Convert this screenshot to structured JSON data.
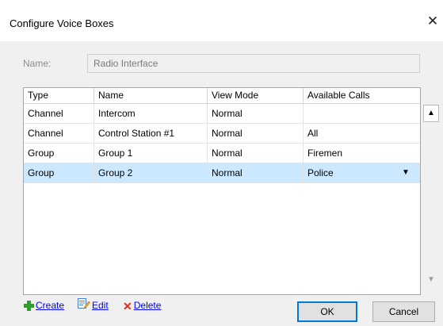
{
  "window": {
    "title": "Configure Voice Boxes",
    "close_glyph": "✕"
  },
  "name_field": {
    "label": "Name:",
    "value": "Radio Interface"
  },
  "grid": {
    "columns": [
      "Type",
      "Name",
      "View Mode",
      "Available Calls"
    ],
    "rows": [
      {
        "type": "Channel",
        "name": "Intercom",
        "view_mode": "Normal",
        "available_calls": ""
      },
      {
        "type": "Channel",
        "name": "Control Station #1",
        "view_mode": "Normal",
        "available_calls": "All"
      },
      {
        "type": "Group",
        "name": "Group 1",
        "view_mode": "Normal",
        "available_calls": "Firemen"
      },
      {
        "type": "Group",
        "name": "Group 2",
        "view_mode": "Normal",
        "available_calls": "Police",
        "selected": true
      }
    ],
    "dropdown_glyph": "▼"
  },
  "scrollbar": {
    "up_glyph": "▲",
    "down_glyph": "▼"
  },
  "actions": {
    "create": {
      "label": "Create",
      "icon": "plus-icon"
    },
    "edit": {
      "label": "Edit",
      "icon": "edit-icon"
    },
    "delete": {
      "label": "Delete",
      "icon": "delete-x-icon",
      "glyph": "✕"
    }
  },
  "buttons": {
    "ok": "OK",
    "cancel": "Cancel"
  },
  "colors": {
    "selected_row": "#cce8ff",
    "link": "#0000ee",
    "default_button_border": "#0078d7"
  }
}
